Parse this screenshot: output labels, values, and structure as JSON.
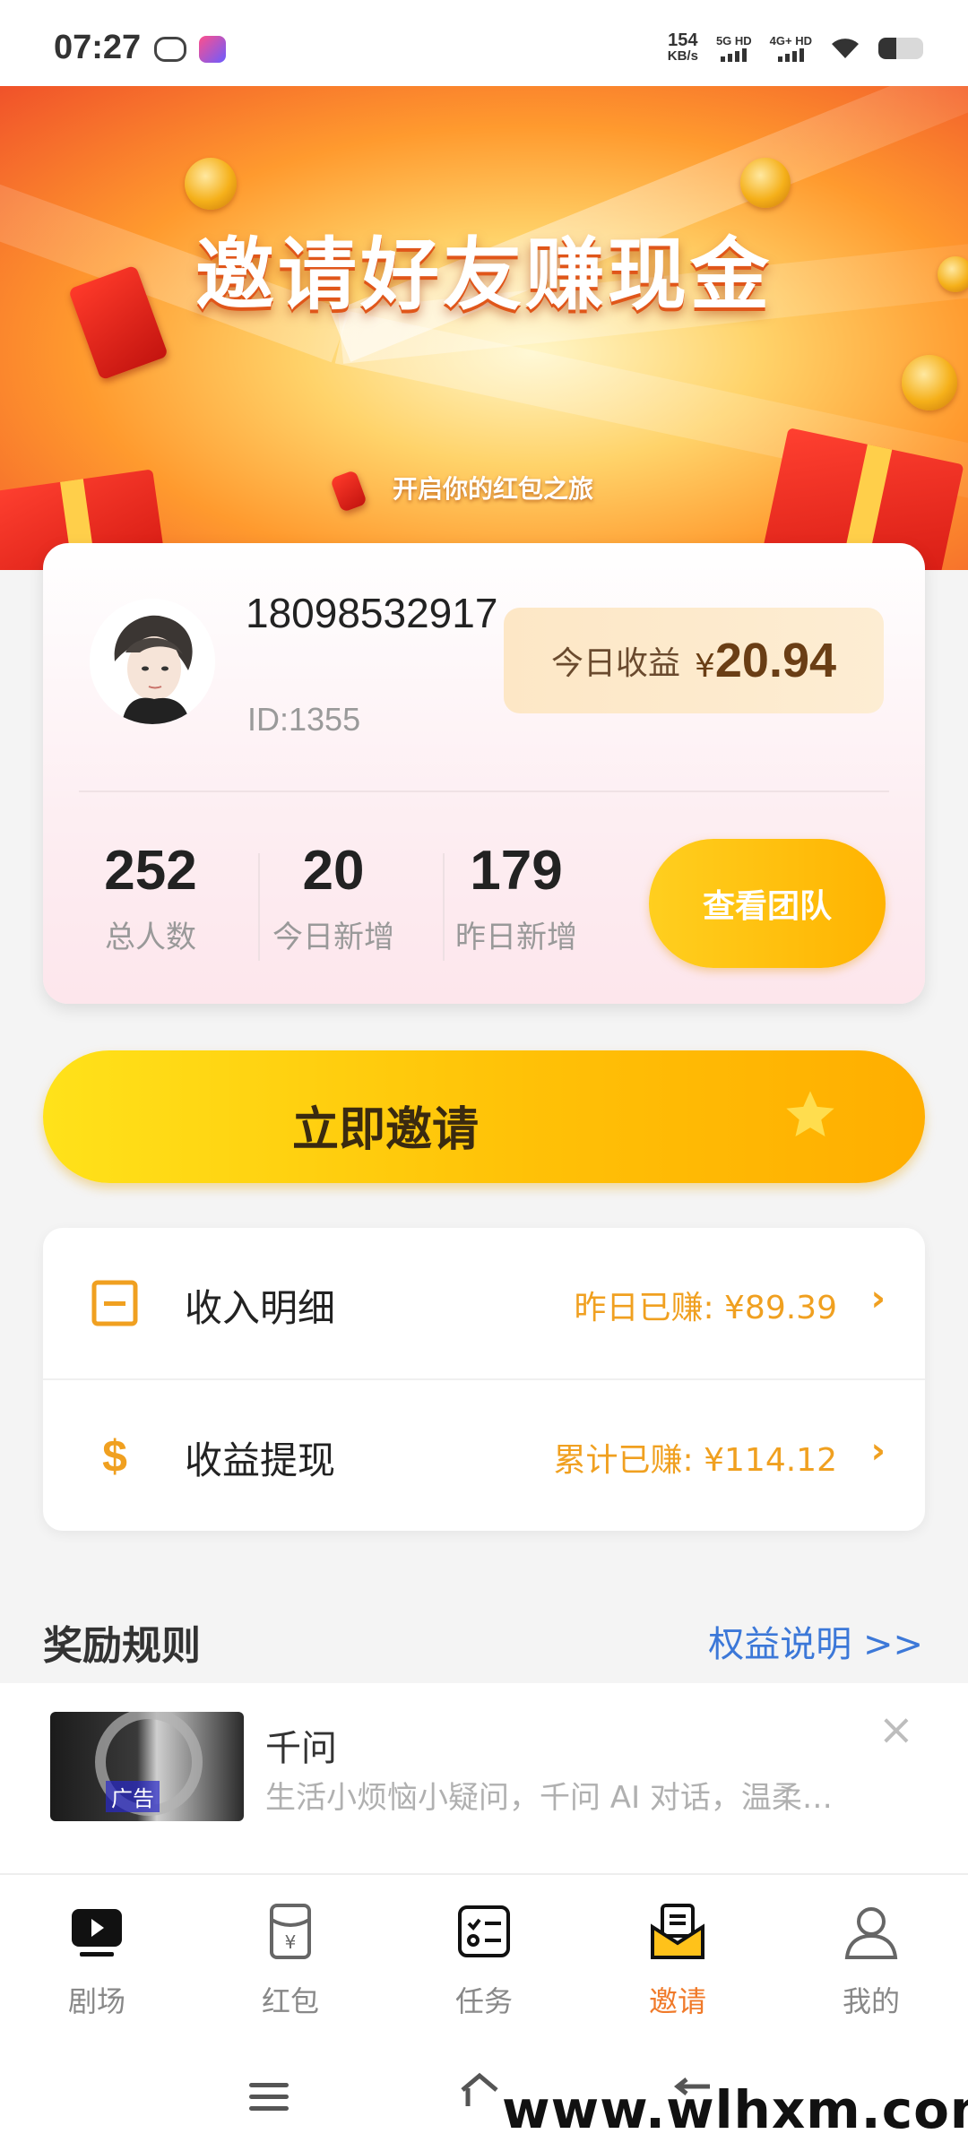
{
  "status_bar": {
    "time": "07:27",
    "net_speed_value": "154",
    "net_speed_unit": "KB/s",
    "sim1_label": "5G HD",
    "sim2_label": "4G+ HD",
    "icons": [
      "wechat-icon",
      "app-notification-icon",
      "signal-icon",
      "wifi-icon",
      "battery-icon"
    ]
  },
  "banner": {
    "title": "邀请好友赚现金",
    "subtitle": "开启你的红包之旅"
  },
  "profile": {
    "phone": "18098532917",
    "id_text": "ID:1355",
    "today_earnings_label": "今日收益",
    "currency": "¥",
    "today_earnings_value": "20.94",
    "stats": [
      {
        "value": "252",
        "label": "总人数"
      },
      {
        "value": "20",
        "label": "今日新增"
      },
      {
        "value": "179",
        "label": "昨日新增"
      }
    ],
    "team_button": "查看团队"
  },
  "invite_button": "立即邀请",
  "list": {
    "income": {
      "label": "收入明细",
      "value": "昨日已赚: ¥89.39",
      "chevron": "›"
    },
    "withdraw": {
      "label": "收益提现",
      "value": "累计已赚: ¥114.12",
      "chevron": "›"
    }
  },
  "rules": {
    "title": "奖励规则",
    "link": "权益说明 >>"
  },
  "ad": {
    "tag": "广告",
    "title": "千问",
    "description": "生活小烦恼小疑问，千问 AI 对话，温柔…",
    "close": "×"
  },
  "tabs": [
    {
      "label": "剧场",
      "icon": "play-screen-icon",
      "active": false
    },
    {
      "label": "红包",
      "icon": "red-envelope-icon",
      "active": false
    },
    {
      "label": "任务",
      "icon": "task-list-icon",
      "active": false
    },
    {
      "label": "邀请",
      "icon": "invite-mail-icon",
      "active": true
    },
    {
      "label": "我的",
      "icon": "user-icon",
      "active": false
    }
  ],
  "watermark": "www.wlhxm.com",
  "colors": {
    "accent_orange": "#f07a2a",
    "gold": "#ffc107",
    "value_orange": "#f0a020",
    "link_blue": "#3c78d8"
  }
}
